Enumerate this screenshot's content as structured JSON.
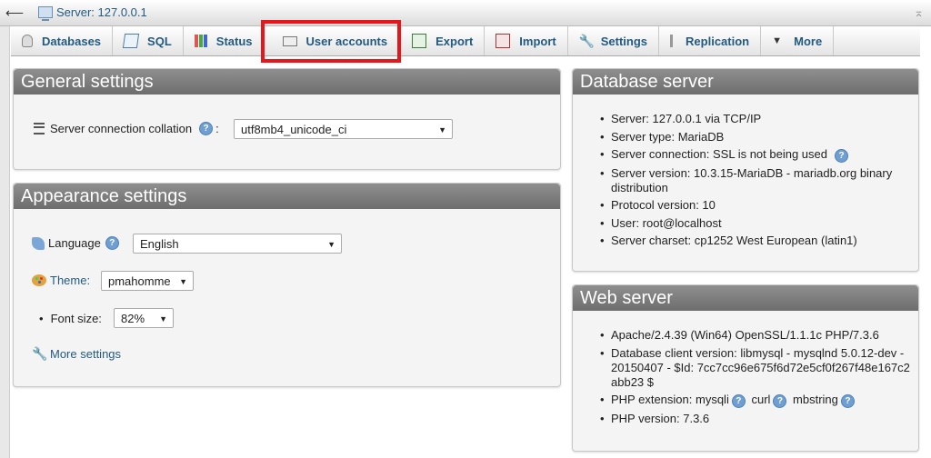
{
  "window": {
    "server_crumb": "Server: 127.0.0.1"
  },
  "tabs": [
    {
      "label": "Databases",
      "icon": "database-icon"
    },
    {
      "label": "SQL",
      "icon": "sql-icon"
    },
    {
      "label": "Status",
      "icon": "status-icon"
    },
    {
      "label": "User accounts",
      "icon": "user-accounts-icon"
    },
    {
      "label": "Export",
      "icon": "export-icon"
    },
    {
      "label": "Import",
      "icon": "import-icon"
    },
    {
      "label": "Settings",
      "icon": "wrench-icon"
    },
    {
      "label": "Replication",
      "icon": "replication-icon"
    },
    {
      "label": "More",
      "icon": "triangle-down-icon"
    }
  ],
  "annotation": {
    "color": "#e8151b"
  },
  "general": {
    "title": "General settings",
    "collation_label": "Server connection collation",
    "collation_value": "utf8mb4_unicode_ci"
  },
  "appearance": {
    "title": "Appearance settings",
    "language_label": "Language",
    "language_value": "English",
    "theme_label": "Theme:",
    "theme_value": "pmahomme",
    "fontsize_label": "Font size:",
    "fontsize_value": "82%",
    "more_settings": "More settings"
  },
  "db_server": {
    "title": "Database server",
    "items": [
      "Server: 127.0.0.1 via TCP/IP",
      "Server type: MariaDB",
      "Server connection: SSL is not being used",
      "Server version: 10.3.15-MariaDB - mariadb.org binary distribution",
      "Protocol version: 10",
      "User: root@localhost",
      "Server charset: cp1252 West European (latin1)"
    ]
  },
  "web_server": {
    "title": "Web server",
    "items": [
      "Apache/2.4.39 (Win64) OpenSSL/1.1.1c PHP/7.3.6",
      "Database client version: libmysql - mysqlnd 5.0.12-dev - 20150407 - $Id: 7cc7cc96e675f6d72e5cf0f267f48e167c2abb23 $",
      "PHP version: 7.3.6"
    ],
    "php_ext": {
      "label": "PHP extension:",
      "exts": [
        "mysqli",
        "curl",
        "mbstring"
      ]
    }
  }
}
